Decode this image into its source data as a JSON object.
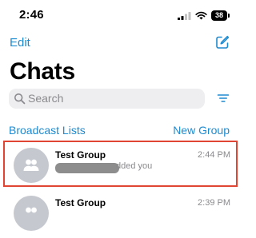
{
  "status_bar": {
    "time": "2:46",
    "battery": "38",
    "icons": [
      "signal-icon",
      "wifi-icon",
      "battery-icon"
    ]
  },
  "nav": {
    "edit_label": "Edit",
    "compose_icon": "compose-icon"
  },
  "title": "Chats",
  "search": {
    "placeholder": "Search",
    "filter_icon": "filter-icon"
  },
  "links": {
    "broadcast": "Broadcast Lists",
    "new_group": "New Group"
  },
  "chats": [
    {
      "name": "Test Group",
      "time": "2:44 PM",
      "preview": "dded you",
      "avatar_icon": "group-icon",
      "redacted": true,
      "highlighted": true
    },
    {
      "name": "Test Group",
      "time": "2:39 PM",
      "preview": "",
      "avatar_icon": "group-icon",
      "redacted": false,
      "highlighted": false
    }
  ],
  "colors": {
    "accent": "#1e8bd0",
    "highlight_border": "#e04534",
    "secondary_text": "#8a8a8e",
    "avatar_bg": "#c5c8ce"
  }
}
